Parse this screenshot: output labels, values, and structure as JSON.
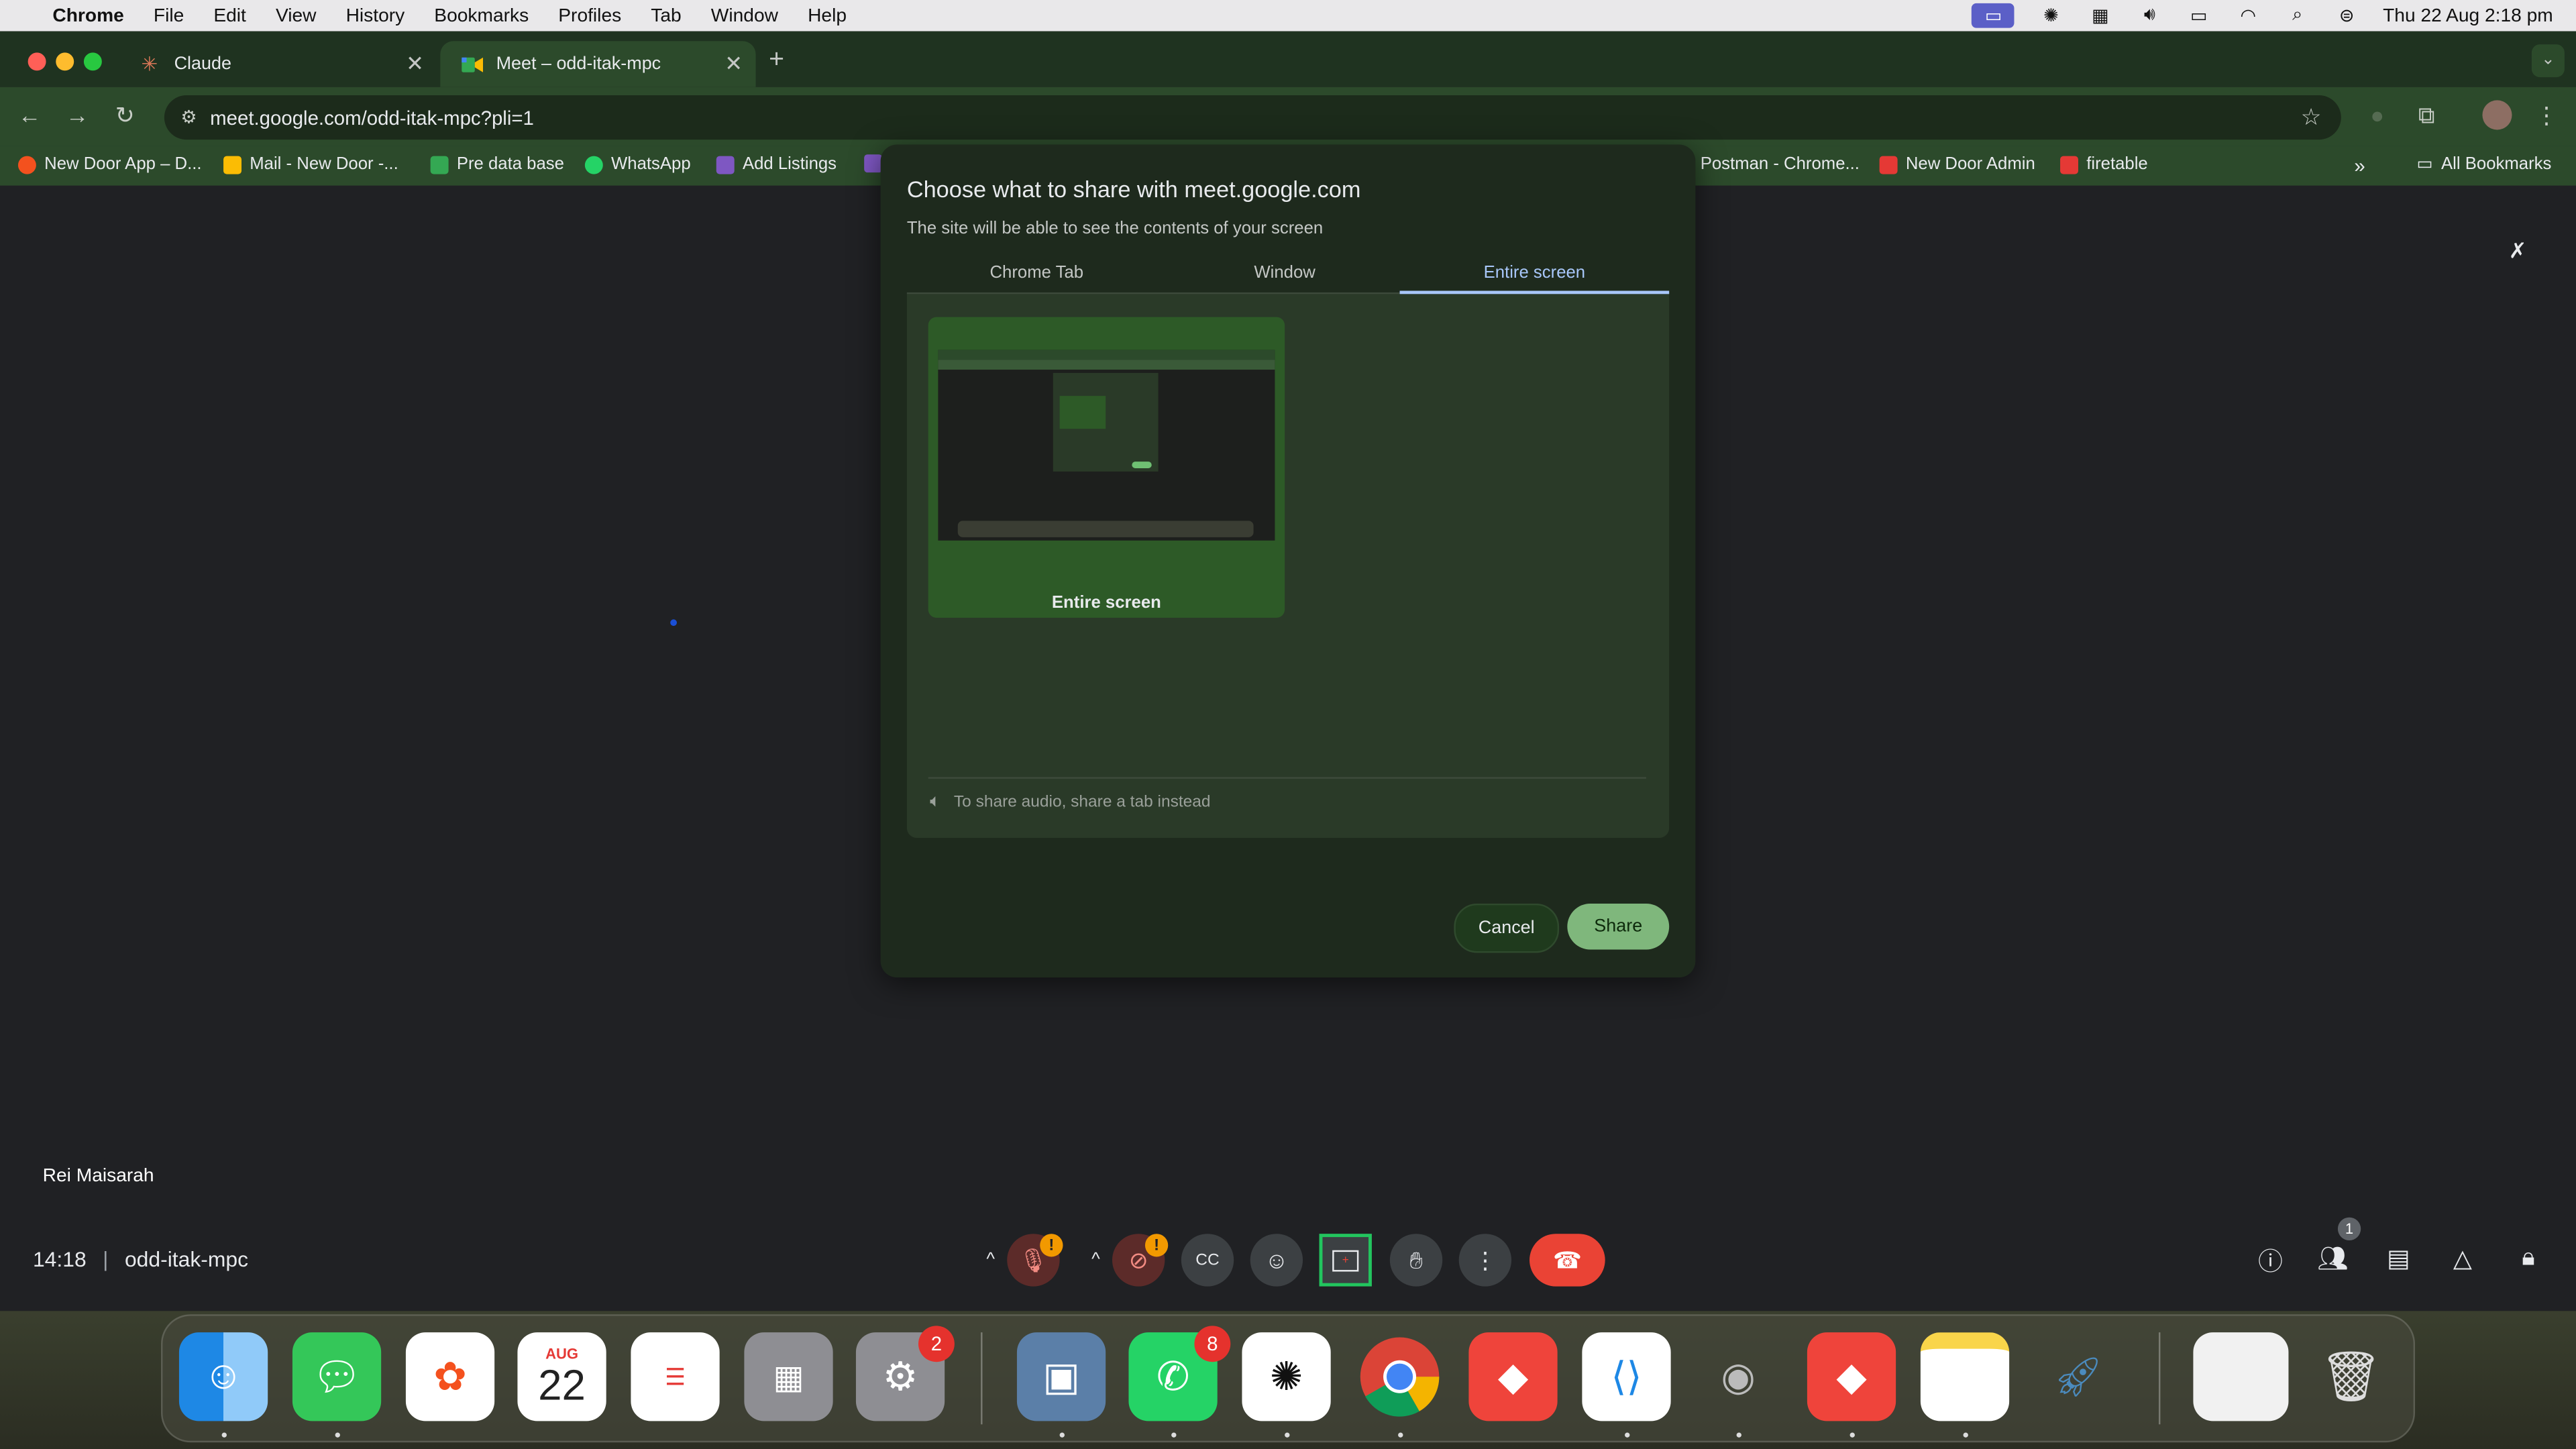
{
  "menubar": {
    "app": "Chrome",
    "items": [
      "File",
      "Edit",
      "View",
      "History",
      "Bookmarks",
      "Profiles",
      "Tab",
      "Window",
      "Help"
    ],
    "datetime": "Thu 22 Aug  2:18 pm"
  },
  "tabs": [
    {
      "title": "Claude",
      "icon": "claude-icon",
      "active": false
    },
    {
      "title": "Meet – odd-itak-mpc",
      "icon": "meet-icon",
      "active": true
    }
  ],
  "address": {
    "url": "meet.google.com/odd-itak-mpc?pli=1"
  },
  "bookmarks": {
    "items": [
      {
        "label": "New Door App – D...",
        "color": "#f4511e"
      },
      {
        "label": "Mail - New Door -...",
        "color": "#fbbc04"
      },
      {
        "label": "Pre data base",
        "color": "#34a853"
      },
      {
        "label": "WhatsApp",
        "color": "#25d366"
      },
      {
        "label": "Add Listings",
        "color": "#7e57c2"
      },
      {
        "label": "Postman - Chrome...",
        "color": ""
      },
      {
        "label": "New Door Admin",
        "color": "#e53935"
      },
      {
        "label": "firetable",
        "color": "#e53935"
      }
    ],
    "all_label": "All Bookmarks"
  },
  "dialog": {
    "title": "Choose what to share with meet.google.com",
    "subtitle": "The site will be able to see the contents of your screen",
    "tabs": [
      "Chrome Tab",
      "Window",
      "Entire screen"
    ],
    "active_tab": "Entire screen",
    "thumbnail_label": "Entire screen",
    "audio_note": "To share audio, share a tab instead",
    "cancel": "Cancel",
    "share": "Share"
  },
  "meet": {
    "participant": "Rei Maisarah",
    "time": "14:18",
    "code": "odd-itak-mpc",
    "people_count": "1",
    "accent": "#ea4335"
  },
  "dock": {
    "badges": {
      "settings": "2",
      "whatsapp": "8"
    },
    "calendar_month": "AUG",
    "calendar_day": "22"
  }
}
